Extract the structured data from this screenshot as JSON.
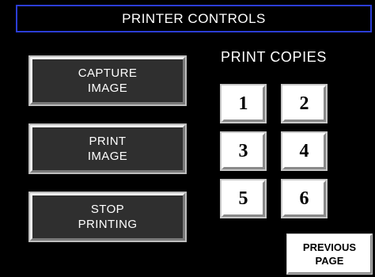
{
  "header": {
    "title": "PRINTER CONTROLS"
  },
  "actions": {
    "capture_label": "CAPTURE\nIMAGE",
    "print_label": "PRINT\nIMAGE",
    "stop_label": "STOP\nPRINTING"
  },
  "copies": {
    "section_label": "PRINT COPIES",
    "buttons": [
      "1",
      "2",
      "3",
      "4",
      "5",
      "6"
    ]
  },
  "navigation": {
    "previous_label": "PREVIOUS\nPAGE"
  },
  "colors": {
    "background": "#000000",
    "title_border": "#2b3dd6",
    "dark_button": "#2f2f2f",
    "light_button": "#ffffff"
  }
}
